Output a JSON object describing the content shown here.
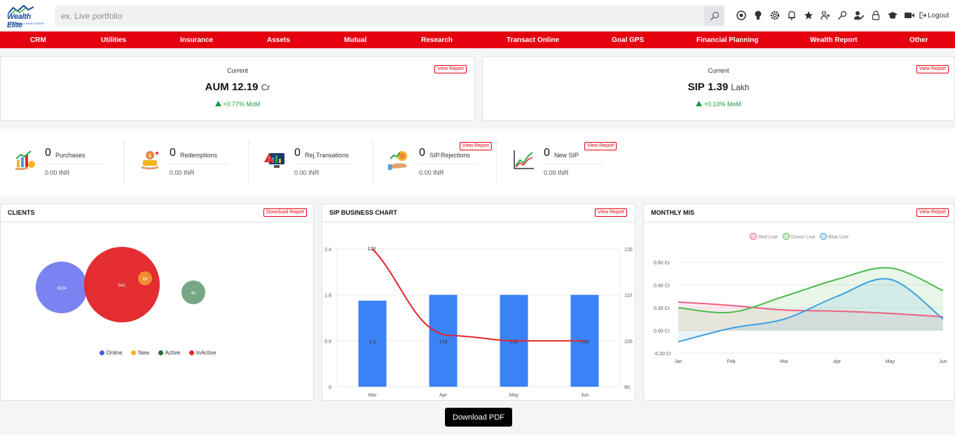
{
  "app": {
    "logo_text": "Wealth Elite",
    "logo_sub": "INVESTMENT MADE EASIER"
  },
  "search": {
    "placeholder": "ex. Live portfolio"
  },
  "top_icons": [
    "target-icon",
    "bulb-icon",
    "gear-icon",
    "bell-icon",
    "star-icon",
    "user-add-icon",
    "key-icon",
    "user-edit-icon",
    "lock-icon",
    "graduation-cap-icon",
    "video-icon"
  ],
  "logout_label": "Logout",
  "menu": [
    "CRM",
    "Utilities",
    "Insurance",
    "Assets",
    "Mutual",
    "Research",
    "Transact Online",
    "Goal GPS",
    "Financial Planning",
    "Wealth Report",
    "Other"
  ],
  "aum": {
    "label": "Current",
    "name": "AUM",
    "value": "12.19",
    "unit": "Cr",
    "change": "+0.77% MoM",
    "report": "View Report"
  },
  "sip": {
    "label": "Current",
    "name": "SIP",
    "value": "1.39",
    "unit": "Lakh",
    "change": "+0.10% MoM",
    "report": "View Report"
  },
  "stats": [
    {
      "count": "0",
      "name": "Purchases",
      "amount": "0.00 INR",
      "icon": "purchases-icon"
    },
    {
      "count": "0",
      "name": "Redemptions",
      "amount": "0.00 INR",
      "icon": "redemptions-icon"
    },
    {
      "count": "0",
      "name": "Rej.Transations",
      "amount": "0.00 INR",
      "icon": "rejected-transactions-icon"
    },
    {
      "count": "0",
      "name": "SIP.Rejections",
      "amount": "0.00 INR",
      "icon": "sip-rejections-icon",
      "report": "View Report"
    },
    {
      "count": "0",
      "name": "New SIP",
      "amount": "0.00 INR",
      "icon": "new-sip-icon",
      "report": "View Report"
    }
  ],
  "clients": {
    "title": "CLIENTS",
    "report": "Download Report",
    "chart_data": {
      "type": "bubble",
      "series": [
        {
          "name": "Online",
          "value": 3224,
          "color": "#7b83f2"
        },
        {
          "name": "New",
          "value": 69,
          "color": "#f0a030"
        },
        {
          "name": "Active",
          "value": 40,
          "color": "#4a8a5c"
        },
        {
          "name": "InActive",
          "value": 541,
          "color": "#e3262a"
        }
      ]
    },
    "legend": [
      {
        "name": "Online",
        "color": "#3b5ce8"
      },
      {
        "name": "New",
        "color": "#f5b31c"
      },
      {
        "name": "Active",
        "color": "#1f6b3a"
      },
      {
        "name": "InActive",
        "color": "#e3262a"
      }
    ]
  },
  "sip_chart": {
    "title": "SIP BUSINESS CHART",
    "report": "View Report",
    "chart_data": {
      "type": "bar",
      "categories": [
        "Mar",
        "Apr",
        "May",
        "Jun"
      ],
      "series": [
        {
          "values": [
            1.5,
            1.6,
            1.6,
            1.6
          ],
          "color": "#3b82f6",
          "labels": [
            "1.5",
            "108",
            "108",
            "108"
          ]
        },
        {
          "type": "line",
          "values": [
            120,
            103,
            100,
            100
          ],
          "color": "#e3262a"
        }
      ],
      "y_left": {
        "ticks": [
          "0",
          "0.8",
          "1.6",
          "2.4"
        ],
        "range": [
          0,
          2.4
        ]
      },
      "y_right": {
        "ticks": [
          "90",
          "100",
          "110",
          "120"
        ],
        "range": [
          90,
          120
        ]
      },
      "line_top_label": "120"
    }
  },
  "mis": {
    "title": "MONTHLY MIS",
    "report": "View Report",
    "chart_data": {
      "type": "line",
      "categories": [
        "Jan",
        "Feb",
        "Mar",
        "Apr",
        "May",
        "Jun"
      ],
      "series": [
        {
          "name": "Red Line",
          "values": [
            0.25,
            0.22,
            0.18,
            0.17,
            0.15,
            0.12
          ],
          "color": "#f06080"
        },
        {
          "name": "Green Line",
          "values": [
            0.2,
            0.16,
            0.3,
            0.45,
            0.55,
            0.35
          ],
          "color": "#4cbb4c"
        },
        {
          "name": "Blue Line",
          "values": [
            -0.1,
            0.02,
            0.1,
            0.3,
            0.45,
            0.1
          ],
          "color": "#3fa0e0"
        }
      ],
      "y_ticks": [
        "0.60 Cr",
        "0.40 Cr",
        "0.20 Cr",
        "0.00 Cr",
        "-0.20 Cr"
      ],
      "ylim": [
        -0.2,
        0.6
      ]
    }
  },
  "download_pdf": "Download PDF"
}
